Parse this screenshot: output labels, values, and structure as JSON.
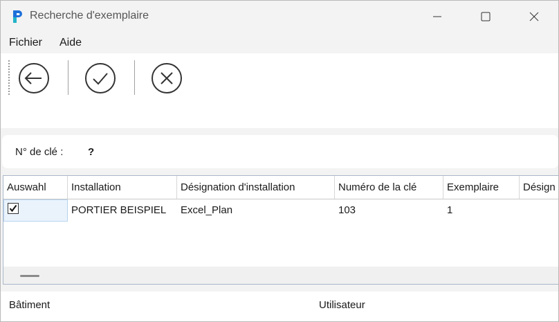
{
  "window": {
    "title": "Recherche d'exemplaire"
  },
  "menu": {
    "items": [
      "Fichier",
      "Aide"
    ]
  },
  "toolbar": {
    "buttons": [
      "back-arrow-icon",
      "check-circle-icon",
      "cancel-circle-icon"
    ]
  },
  "key_panel": {
    "label": "N° de clé :",
    "value": "?"
  },
  "grid": {
    "columns": [
      "Auswahl",
      "Installation",
      "Désignation d'installation",
      "Numéro de la clé",
      "Exemplaire",
      "Désign"
    ],
    "rows": [
      {
        "selected": true,
        "installation": "PORTIER BEISPIEL",
        "designation": "Excel_Plan",
        "key_number": "103",
        "copy": "1",
        "extra": ""
      }
    ]
  },
  "status": {
    "building": "Bâtiment",
    "user": "Utilisateur"
  },
  "colors": {
    "window_bg": "#f3f3f3",
    "panel_bg": "#ffffff",
    "selection_bg": "#eaf3fc",
    "app_icon_blue": "#1e6fd9"
  }
}
